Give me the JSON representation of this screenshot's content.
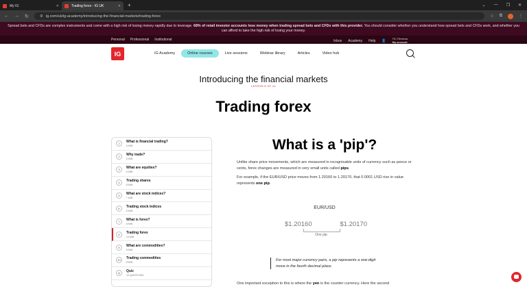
{
  "browser": {
    "tabs": [
      {
        "label": "My IG"
      },
      {
        "label": "Trading forex - IG UK"
      }
    ],
    "url": "ig.com/uk/ig-academy/introducing-the-financial-markets/trading-forex"
  },
  "risk_warning": {
    "before": "Spread bets and CFDs are complex instruments and come with a high risk of losing money rapidly due to leverage.",
    "bold": "68% of retail investor accounts lose money when trading spread bets and CFDs with this provider.",
    "after": "You should consider whether you understand how spread bets and CFDs work, and whether you can afford to take the high risk of losing your money."
  },
  "header": {
    "segments": [
      "Personal",
      "Professional",
      "Institutional"
    ],
    "right_links": [
      "Inbox",
      "Academy",
      "Help"
    ],
    "account_name": "TIC Reviews",
    "account_label": "My account",
    "logo": "IG",
    "nav": [
      "IG Academy",
      "Online courses",
      "Live sessions",
      "Webinar library",
      "Articles",
      "Video hub"
    ]
  },
  "page": {
    "course_title": "Introducing the financial markets",
    "lesson_tag": "LESSON 8 OF 10",
    "lesson_title": "Trading forex"
  },
  "sidebar": {
    "items": [
      {
        "num": "1",
        "title": "What is financial trading?",
        "meta": "6 MIN"
      },
      {
        "num": "2",
        "title": "Why trade?",
        "meta": "5 MIN"
      },
      {
        "num": "3",
        "title": "What are equities?",
        "meta": "6 MIN"
      },
      {
        "num": "4",
        "title": "Trading shares",
        "meta": "8 MIN"
      },
      {
        "num": "5",
        "title": "What are stock indices?",
        "meta": "7 MIN"
      },
      {
        "num": "6",
        "title": "Trading stock indices",
        "meta": "5 MIN"
      },
      {
        "num": "7",
        "title": "What is forex?",
        "meta": "8 MIN"
      },
      {
        "num": "8",
        "title": "Trading forex",
        "meta": "14 MIN"
      },
      {
        "num": "9",
        "title": "What are commodities?",
        "meta": "8 MIN"
      },
      {
        "num": "10",
        "title": "Trading commodities",
        "meta": "8 MIN"
      },
      {
        "num": "Q",
        "title": "Quiz",
        "meta": "10 QUESTIONS"
      }
    ]
  },
  "content": {
    "heading": "What is a 'pip'?",
    "p1_a": "Unlike share price movements, which are measured in recognisable units of currency such as pence or cents, forex changes are measured in very small units called",
    "p1_b": "pips",
    "p2_a": "For example, if the EUR/USD price moves from 1.20160 to 1.20170, that 0.0001 USD rise in value represents",
    "p2_b": "one pip",
    "pair": "EUR/USD",
    "price_from": "$1.20160",
    "price_to": "$1.20170",
    "pip_label": "One pip",
    "quote": "For most major currency pairs, a pip represents a one-digit move in the fourth decimal place.",
    "p3_a": "One important exception to this is where the",
    "p3_b": "yen",
    "p3_c": "is the counter currency. Here the second"
  }
}
